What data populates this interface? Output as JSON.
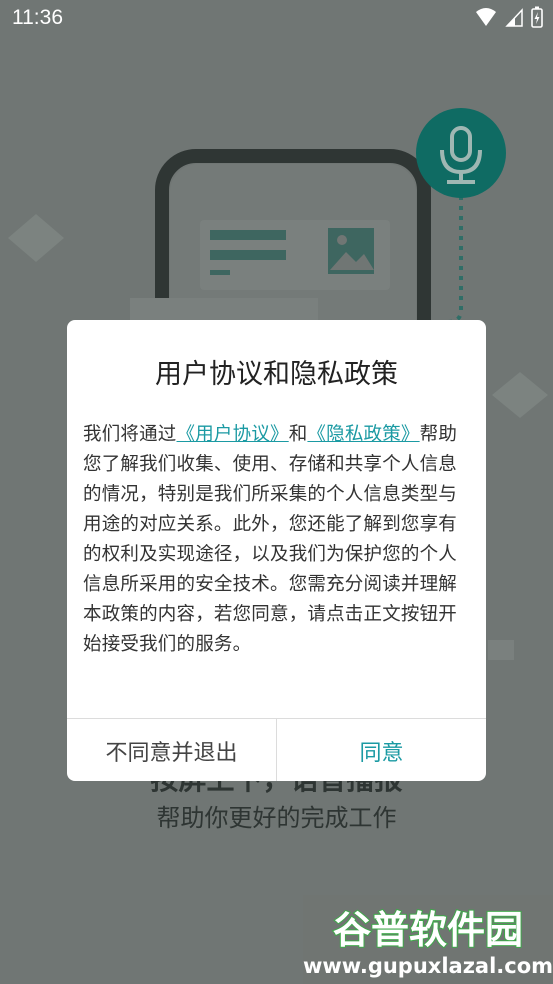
{
  "status_bar": {
    "time": "11:36"
  },
  "background": {
    "headline": "按屏上下，语音播报",
    "subline": "帮助你更好的完成工作"
  },
  "dialog": {
    "title": "用户协议和隐私政策",
    "body": {
      "p1": "我们将通过",
      "link_user_agreement": "《用户协议》",
      "and": "和",
      "link_privacy_policy": "《隐私政策》",
      "rest": "帮助您了解我们收集、使用、存储和共享个人信息的情况，特别是我们所采集的个人信息类型与用途的对应关系。此外，您还能了解到您享有的权利及实现途径，以及我们为保护您的个人信息所采用的安全技术。您需充分阅读并理解本政策的内容，若您同意，请点击正文按钮开始接受我们的服务。"
    },
    "decline_label": "不同意并退出",
    "accept_label": "同意"
  },
  "watermark": {
    "brand": "谷普软件园",
    "url": "www.gupuxlazal.com"
  },
  "colors": {
    "accent": "#1b9aa3",
    "mic_circle": "#0f6b63",
    "overlay_bg": "#707674"
  }
}
